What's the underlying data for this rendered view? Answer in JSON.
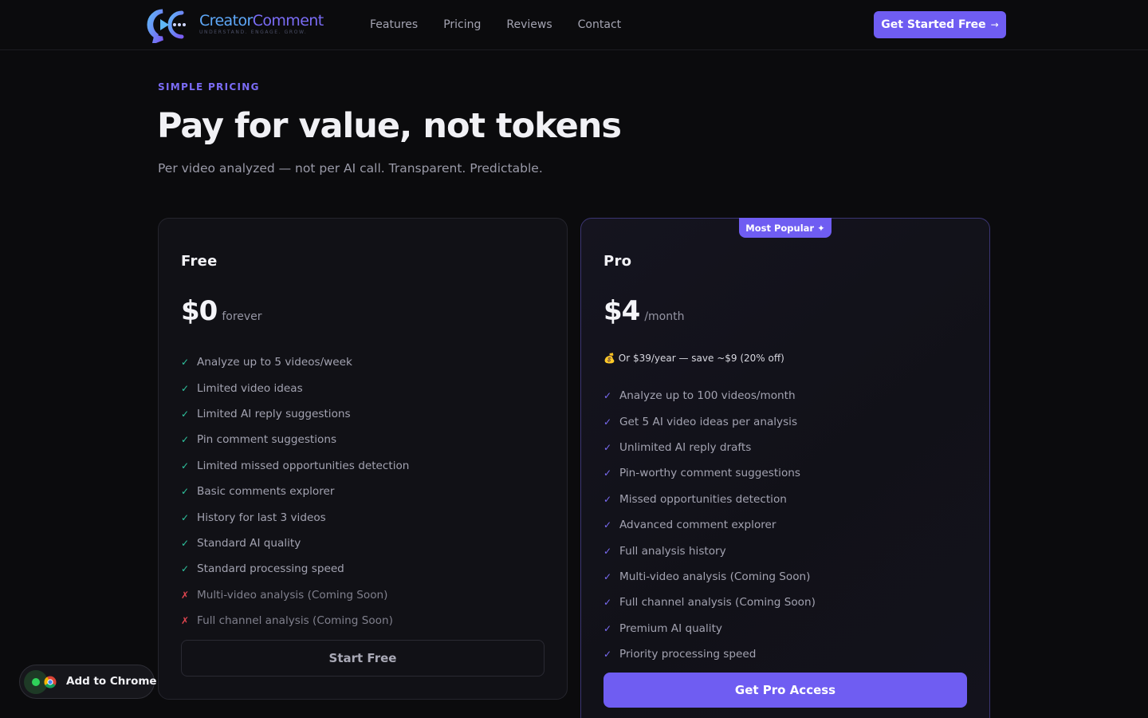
{
  "brand": {
    "name_part1": "Creator",
    "name_part2": "Comment",
    "tagline": "UNDERSTAND. ENGAGE. GROW."
  },
  "nav": {
    "links": [
      "Features",
      "Pricing",
      "Reviews",
      "Contact"
    ],
    "cta_label": "Get Started Free",
    "cta_arrow": "→"
  },
  "hero": {
    "eyebrow": "SIMPLE PRICING",
    "title": "Pay for value, not tokens",
    "subtitle": "Per video analyzed — not per AI call. Transparent. Predictable."
  },
  "plans": {
    "free": {
      "name": "Free",
      "price": "$0",
      "period": "forever",
      "features": [
        {
          "text": "Analyze up to 5 videos/week",
          "included": true
        },
        {
          "text": "Limited video ideas",
          "included": true
        },
        {
          "text": "Limited AI reply suggestions",
          "included": true
        },
        {
          "text": "Pin comment suggestions",
          "included": true
        },
        {
          "text": "Limited missed opportunities detection",
          "included": true
        },
        {
          "text": "Basic comments explorer",
          "included": true
        },
        {
          "text": "History for last 3 videos",
          "included": true
        },
        {
          "text": "Standard AI quality",
          "included": true
        },
        {
          "text": "Standard processing speed",
          "included": true
        },
        {
          "text": "Multi-video analysis (Coming Soon)",
          "included": false
        },
        {
          "text": "Full channel analysis (Coming Soon)",
          "included": false
        }
      ],
      "button_label": "Start Free"
    },
    "pro": {
      "badge": "Most Popular ✦",
      "name": "Pro",
      "price": "$4",
      "period": "/month",
      "annual_note": "💰 Or $39/year — save ~$9 (20% off)",
      "features": [
        {
          "text": "Analyze up to 100 videos/month",
          "included": true
        },
        {
          "text": "Get 5 AI video ideas per analysis",
          "included": true
        },
        {
          "text": "Unlimited AI reply drafts",
          "included": true
        },
        {
          "text": "Pin-worthy comment suggestions",
          "included": true
        },
        {
          "text": "Missed opportunities detection",
          "included": true
        },
        {
          "text": "Advanced comment explorer",
          "included": true
        },
        {
          "text": "Full analysis history",
          "included": true
        },
        {
          "text": "Multi-video analysis (Coming Soon)",
          "included": true
        },
        {
          "text": "Full channel analysis (Coming Soon)",
          "included": true
        },
        {
          "text": "Premium AI quality",
          "included": true
        },
        {
          "text": "Priority processing speed",
          "included": true
        }
      ],
      "button_label": "Get Pro Access"
    }
  },
  "marks": {
    "check": "✓",
    "cross": "✗"
  },
  "chrome_pill": {
    "label": "Add to Chrome",
    "status": "online"
  },
  "colors": {
    "accent": "#6f5df2",
    "check_free": "#2fc6a0",
    "check_pro": "#7b6cf6",
    "cross": "#e0454f",
    "background": "#0b0b0d"
  },
  "icons": {
    "logo": "chat-bubble-logo-icon",
    "browser": "chrome-icon"
  }
}
